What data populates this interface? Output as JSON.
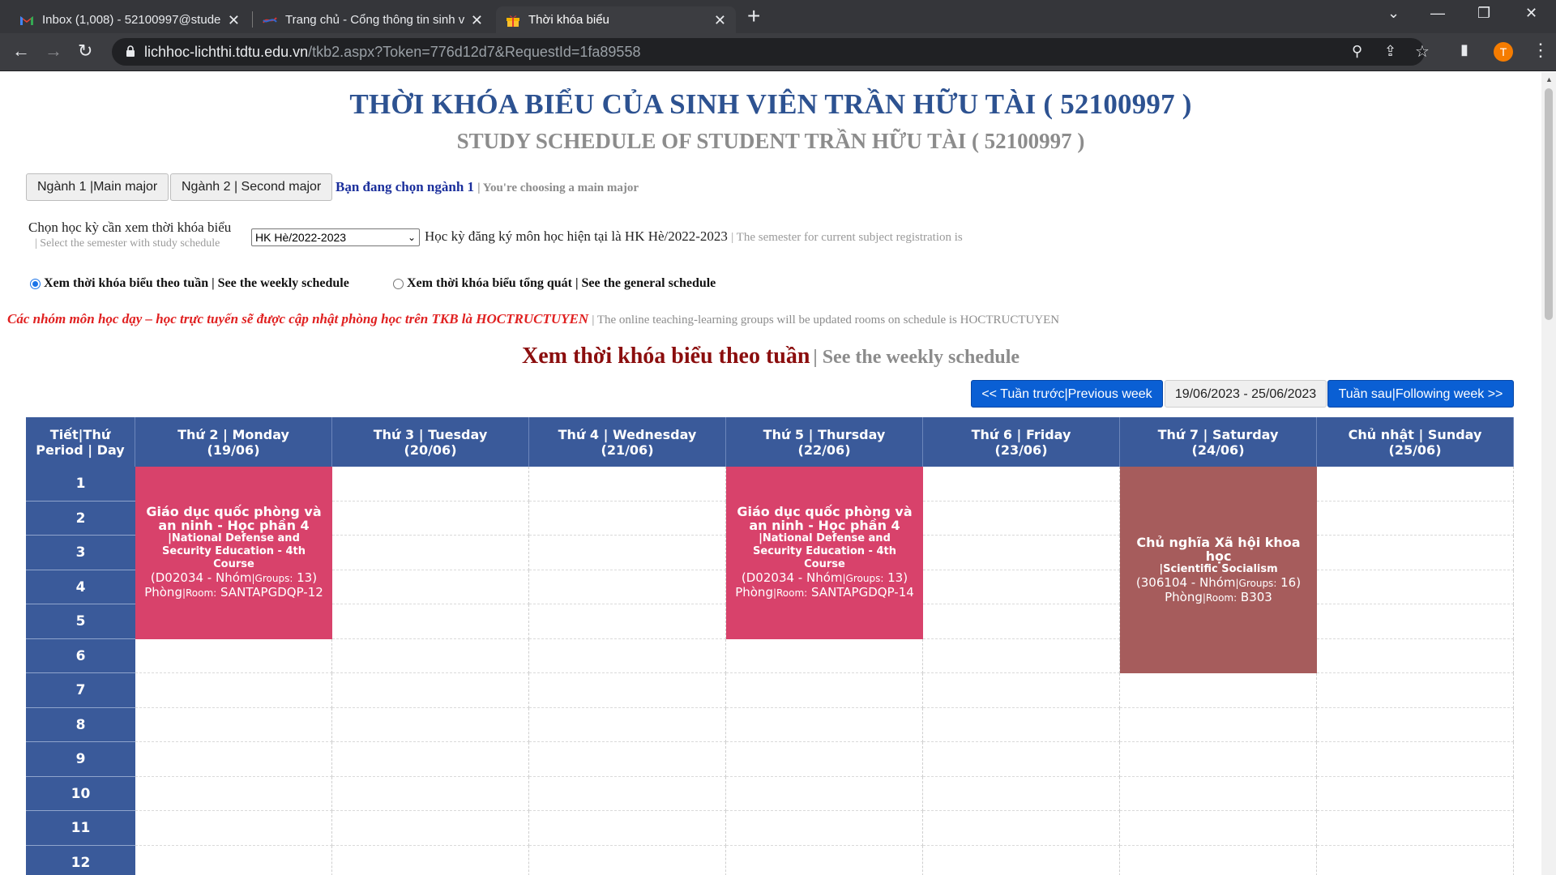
{
  "browser": {
    "tabs": [
      {
        "title": "Inbox (1,008) - 52100997@stude",
        "icon": "gmail-icon"
      },
      {
        "title": "Trang chủ - Cổng thông tin sinh v",
        "icon": "tdtu-logo-icon"
      },
      {
        "title": "Thời khóa biểu",
        "icon": "gift-icon"
      }
    ],
    "url_host": "lichhoc-lichthi.tdtu.edu.vn",
    "url_path": "/tkb2.aspx?Token=776d12d7&RequestId=1fa89558",
    "profile_initial": "T",
    "profile_color": "#f57c00"
  },
  "page": {
    "title_vi": "THỜI KHÓA BIỂU CỦA SINH VIÊN TRẦN HỮU TÀI ( 52100997 )",
    "title_en": "STUDY SCHEDULE OF STUDENT TRẦN HỮU TÀI ( 52100997 )",
    "major1_btn": "Ngành 1 |Main major",
    "major2_btn": "Ngành 2 | Second major",
    "choosing_vi": "Bạn đang chọn ngành 1",
    "choosing_en": "| You're choosing a main major",
    "semester_label_vi": "Chọn học kỳ cần xem thời khóa biểu",
    "semester_label_en": "| Select the semester with study schedule",
    "semester_selected": "HK Hè/2022-2023",
    "current_sem_vi": "Học kỳ đăng ký môn học hiện tại là HK Hè/2022-2023",
    "current_sem_en": "| The semester for current subject registration is",
    "radio_weekly": "Xem thời khóa biểu theo tuần | See the weekly schedule",
    "radio_general": "Xem thời khóa biểu tổng quát | See the general schedule",
    "notice_vi": "Các nhóm môn học dạy – học trực tuyến sẽ được cập nhật phòng học trên TKB là HOCTRUCTUYEN",
    "notice_en": "| The online teaching-learning groups will be updated rooms on schedule is HOCTRUCTUYEN",
    "weekly_vi": "Xem thời khóa biểu theo tuần",
    "weekly_en": "| See the weekly schedule",
    "prev_week": "<< Tuần trước|Previous week",
    "week_range": "19/06/2023 - 25/06/2023",
    "next_week": "Tuần sau|Following week >>"
  },
  "timetable": {
    "period_header": [
      "Tiết|Thứ",
      "Period | Day"
    ],
    "days": [
      {
        "label": "Thứ 2 | Monday",
        "date": "(19/06)"
      },
      {
        "label": "Thứ 3 | Tuesday",
        "date": "(20/06)"
      },
      {
        "label": "Thứ 4 | Wednesday",
        "date": "(21/06)"
      },
      {
        "label": "Thứ 5 | Thursday",
        "date": "(22/06)"
      },
      {
        "label": "Thứ 6 | Friday",
        "date": "(23/06)"
      },
      {
        "label": "Thứ 7 | Saturday",
        "date": "(24/06)"
      },
      {
        "label": "Chủ nhật | Sunday",
        "date": "(25/06)"
      }
    ],
    "periods": [
      "1",
      "2",
      "3",
      "4",
      "5",
      "6",
      "7",
      "8",
      "9",
      "10",
      "11",
      "12"
    ],
    "courses": [
      {
        "day": 0,
        "start_period": 1,
        "periods": 5,
        "color": "#d8426b",
        "name_vi": "Giáo dục quốc phòng và an ninh - Học phần 4",
        "name_en": "|National Defense and Security Education - 4th Course",
        "code": "(D02034 - Nhóm",
        "group_small": "|Groups:",
        "group_num": " 13)",
        "room_label": "Phòng",
        "room_small": "|Room:",
        "room": " SANTAPGDQP-12"
      },
      {
        "day": 3,
        "start_period": 1,
        "periods": 5,
        "color": "#d8426b",
        "name_vi": "Giáo dục quốc phòng và an ninh - Học phần 4",
        "name_en": "|National Defense and Security Education - 4th Course",
        "code": "(D02034 - Nhóm",
        "group_small": "|Groups:",
        "group_num": " 13)",
        "room_label": "Phòng",
        "room_small": "|Room:",
        "room": " SANTAPGDQP-14"
      },
      {
        "day": 5,
        "start_period": 1,
        "periods": 6,
        "color": "#a65c5c",
        "name_vi": "Chủ nghĩa Xã hội khoa học",
        "name_en": "|Scientific Socialism",
        "code": "(306104 - Nhóm",
        "group_small": "|Groups:",
        "group_num": " 16)",
        "room_label": "Phòng",
        "room_small": "|Room:",
        "room": " B303"
      }
    ]
  }
}
